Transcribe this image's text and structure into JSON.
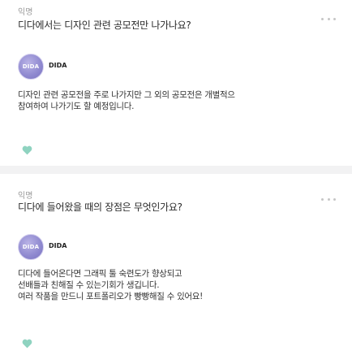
{
  "colors": {
    "heart": "#8fd3c0",
    "avatar": "#8e88cf",
    "divider": "#f2f2f3",
    "meta_text": "#9a9a9a"
  },
  "icons": {
    "more": "more-dots-icon",
    "like": "heart-icon"
  },
  "qna": [
    {
      "tag": "익명",
      "question": "디다에서는 디자인 관련 공모전만 나가나요?",
      "answerer": {
        "avatar_text": "DIDA",
        "name": "DIDA"
      },
      "answer_lines": [
        "디자인 관련 공모전을 주로 나가지만 그 외의 공모전은 개별적으",
        "참여하여 나가기도 할 예정입니다."
      ]
    },
    {
      "tag": "익명",
      "question": "디다에 들어왔을 때의 장점은 무엇인가요?",
      "answerer": {
        "avatar_text": "DIDA",
        "name": "DIDA"
      },
      "answer_lines": [
        "디다에 들어온다면 그래픽 툴 숙련도가 향상되고",
        "선배들과 친해질 수 있는기회가 생깁니다.",
        "여러 작품을 만드니 포트폴리오가 빵빵해질 수 있어요!"
      ]
    }
  ]
}
